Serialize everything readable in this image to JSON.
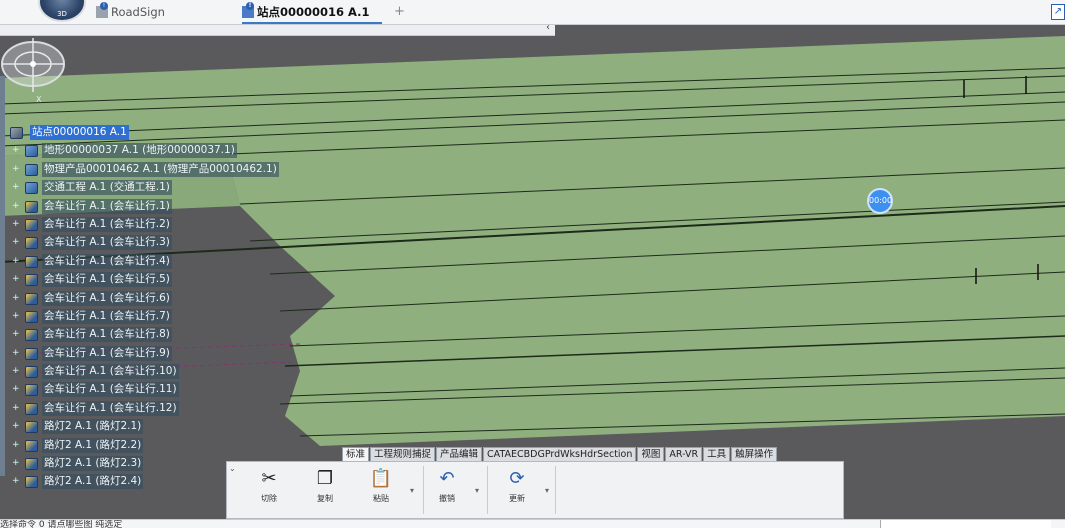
{
  "tabs": {
    "road": "RoadSign",
    "site": "站点00000016 A.1",
    "add": "+"
  },
  "collapse_arrow": "‹",
  "tree": {
    "root": "站点00000016 A.1",
    "items": [
      {
        "label": "地形00000037 A.1 (地形00000037.1)",
        "icon": "terrain-icon"
      },
      {
        "label": "物理产品00010462 A.1 (物理产品00010462.1)",
        "icon": "product-icon"
      },
      {
        "label": "交通工程 A.1 (交通工程.1)",
        "icon": "traffic-icon"
      },
      {
        "label": "会车让行 A.1 (会车让行.1)",
        "icon": "part-icon"
      },
      {
        "label": "会车让行 A.1 (会车让行.2)",
        "icon": "part-icon"
      },
      {
        "label": "会车让行 A.1 (会车让行.3)",
        "icon": "part-icon"
      },
      {
        "label": "会车让行 A.1 (会车让行.4)",
        "icon": "part-icon"
      },
      {
        "label": "会车让行 A.1 (会车让行.5)",
        "icon": "part-icon"
      },
      {
        "label": "会车让行 A.1 (会车让行.6)",
        "icon": "part-icon"
      },
      {
        "label": "会车让行 A.1 (会车让行.7)",
        "icon": "part-icon"
      },
      {
        "label": "会车让行 A.1 (会车让行.8)",
        "icon": "part-icon"
      },
      {
        "label": "会车让行 A.1 (会车让行.9)",
        "icon": "part-icon"
      },
      {
        "label": "会车让行 A.1 (会车让行.10)",
        "icon": "part-icon"
      },
      {
        "label": "会车让行 A.1 (会车让行.11)",
        "icon": "part-icon"
      },
      {
        "label": "会车让行 A.1 (会车让行.12)",
        "icon": "part-icon"
      },
      {
        "label": "路灯2 A.1 (路灯2.1)",
        "icon": "part-icon"
      },
      {
        "label": "路灯2 A.1 (路灯2.2)",
        "icon": "part-icon"
      },
      {
        "label": "路灯2 A.1 (路灯2.3)",
        "icon": "part-icon"
      },
      {
        "label": "路灯2 A.1 (路灯2.4)",
        "icon": "part-icon"
      }
    ]
  },
  "timer": "00:00",
  "compass": {
    "x_label": "X"
  },
  "toolbar": {
    "tabs": [
      "标准",
      "工程规则捕捉",
      "产品编辑",
      "CATAECBDGPrdWksHdrSection",
      "视图",
      "AR-VR",
      "工具",
      "触屏操作"
    ],
    "active_tab": "标准",
    "tools": [
      {
        "label": "切除",
        "glyph": "✂"
      },
      {
        "label": "复制",
        "glyph": "❐"
      },
      {
        "label": "粘贴",
        "glyph": "📋"
      },
      {
        "label": "撤销",
        "glyph": "↶"
      },
      {
        "label": "更新",
        "glyph": "⟳"
      }
    ]
  },
  "status": {
    "text": "选择命令 0 请点哪些图 纯选定"
  },
  "colors": {
    "terrain": "#8faf7e",
    "background": "#5a5a5c",
    "selection": "#2f6fd1"
  }
}
